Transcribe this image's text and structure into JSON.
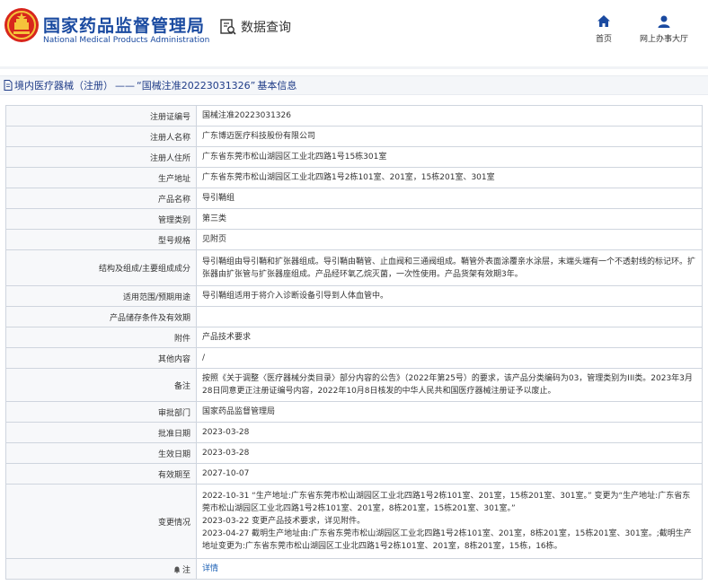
{
  "header": {
    "org_name": "国家药品监督管理局",
    "org_name_en": "National Medical Products Administration",
    "query_label": "数据查询",
    "nav": [
      {
        "label": "首页",
        "icon": "home-icon"
      },
      {
        "label": "网上办事大厅",
        "icon": "user-icon"
      }
    ]
  },
  "breadcrumb": {
    "category": "境内医疗器械（注册）",
    "sep": "——",
    "record": "“国械注准20223031326”",
    "suffix": "基本信息"
  },
  "table": {
    "rows": [
      {
        "label": "注册证编号",
        "value": "国械注准20223031326"
      },
      {
        "label": "注册人名称",
        "value": "广东博迈医疗科技股份有限公司"
      },
      {
        "label": "注册人住所",
        "value": "广东省东莞市松山湖园区工业北四路1号15栋301室"
      },
      {
        "label": "生产地址",
        "value": "广东省东莞市松山湖园区工业北四路1号2栋101室、201室，15栋201室、301室"
      },
      {
        "label": "产品名称",
        "value": "导引鞘组"
      },
      {
        "label": "管理类别",
        "value": "第三类"
      },
      {
        "label": "型号规格",
        "value": "见附页"
      },
      {
        "label": "结构及组成/主要组成成分",
        "value": "导引鞘组由导引鞘和扩张器组成。导引鞘由鞘管、止血阀和三通阀组成。鞘管外表面涂覆亲水涂层，末端头端有一个不透射线的标记环。扩张器由扩张管与扩张器座组成。产品经环氧乙烷灭菌，一次性使用。产品货架有效期3年。"
      },
      {
        "label": "适用范围/预期用途",
        "value": "导引鞘组适用于将介入诊断设备引导到人体血管中。"
      },
      {
        "label": "产品储存条件及有效期",
        "value": ""
      },
      {
        "label": "附件",
        "value": "产品技术要求"
      },
      {
        "label": "其他内容",
        "value": "/"
      },
      {
        "label": "备注",
        "value": "按照《关于调整〈医疗器械分类目录〉部分内容的公告》（2022年第25号）的要求，该产品分类编码为03，管理类别为III类。2023年3月28日同意更正注册证编号内容，2022年10月8日核发的中华人民共和国医疗器械注册证予以废止。"
      },
      {
        "label": "审批部门",
        "value": "国家药品监督管理局"
      },
      {
        "label": "批准日期",
        "value": "2023-03-28"
      },
      {
        "label": "生效日期",
        "value": "2023-03-28"
      },
      {
        "label": "有效期至",
        "value": "2027-10-07"
      }
    ],
    "changes": {
      "label": "变更情况",
      "lines": [
        "2022-10-31 “生产地址:广东省东莞市松山湖园区工业北四路1号2栋101室、201室，15栋201室、301室。” 变更为“生产地址:广东省东莞市松山湖园区工业北四路1号2栋101室、201室，8栋201室，15栋201室、301室。”",
        "2023-03-22 变更产品技术要求，详见附件。",
        "2023-04-27 截明生产地址由:广东省东莞市松山湖园区工业北四路1号2栋101室、201室，8栋201室，15栋201室、301室。;截明生产地址变更为:广东省东莞市松山湖园区工业北四路1号2栋101室、201室，8栋201室，15栋，16栋。"
      ]
    },
    "note": {
      "label": "注",
      "link": "详情"
    }
  }
}
